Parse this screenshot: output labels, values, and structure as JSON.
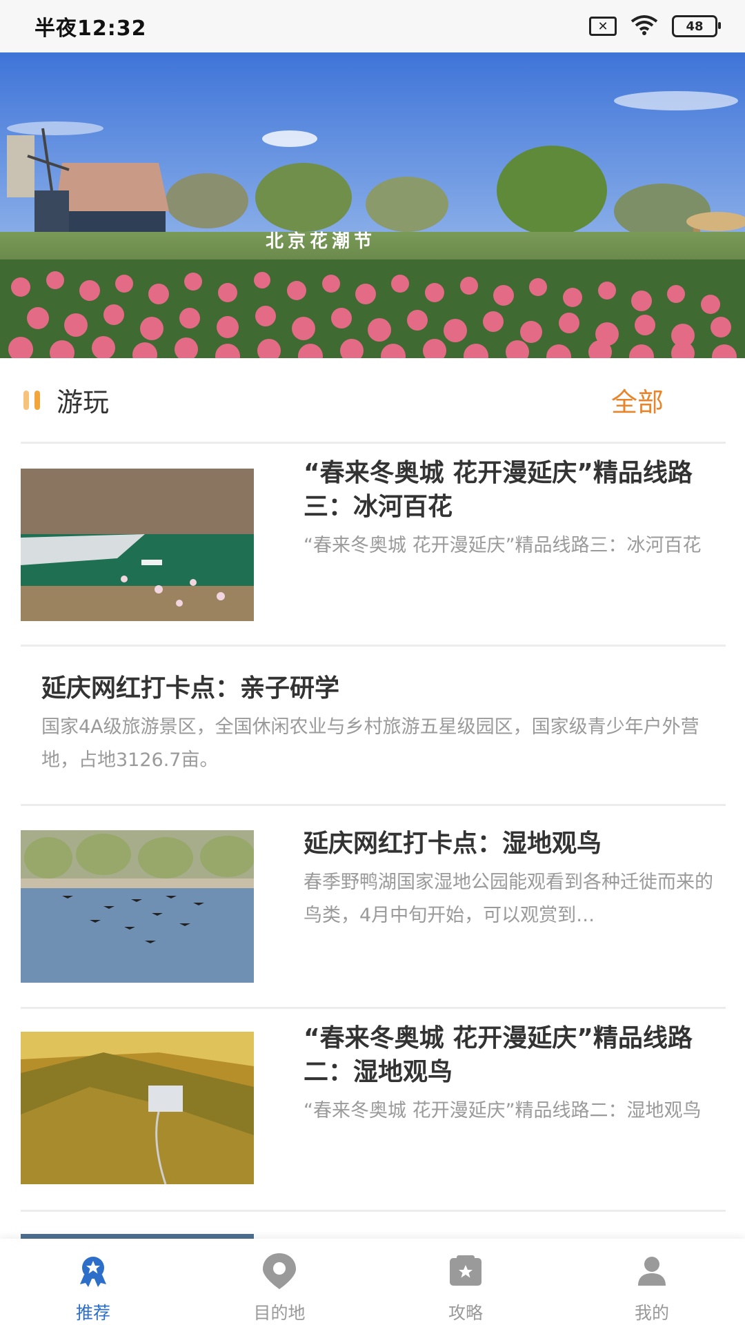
{
  "status_bar": {
    "time": "半夜12:32",
    "battery": "48"
  },
  "section": {
    "title": "游玩",
    "all_label": "全部"
  },
  "articles": [
    {
      "title": "“春来冬奥城 花开漫延庆”精品线路三：冰河百花",
      "desc": "“春来冬奥城 花开漫延庆”精品线路三：冰河百花"
    },
    {
      "title": "延庆网红打卡点：亲子研学",
      "desc": "国家4A级旅游景区，全国休闲农业与乡村旅游五星级园区，国家级青少年户外营地，占地3126.7亩。"
    },
    {
      "title": "延庆网红打卡点：湿地观鸟",
      "desc": "春季野鸭湖国家湿地公园能观看到各种迁徙而来的鸟类，4月中旬开始，可以观赏到…"
    },
    {
      "title": "“春来冬奥城 花开漫延庆”精品线路二：湿地观鸟",
      "desc": "“春来冬奥城 花开漫延庆”精品线路二：湿地观鸟"
    }
  ],
  "bottom_nav": [
    {
      "label": "推荐",
      "icon": "award-icon",
      "active": true
    },
    {
      "label": "目的地",
      "icon": "location-pin-icon",
      "active": false
    },
    {
      "label": "攻略",
      "icon": "guide-book-icon",
      "active": false
    },
    {
      "label": "我的",
      "icon": "user-icon",
      "active": false
    }
  ],
  "colors": {
    "accent": "#e8842a",
    "nav_active": "#2d6fc8",
    "muted": "#9a9a9a"
  }
}
